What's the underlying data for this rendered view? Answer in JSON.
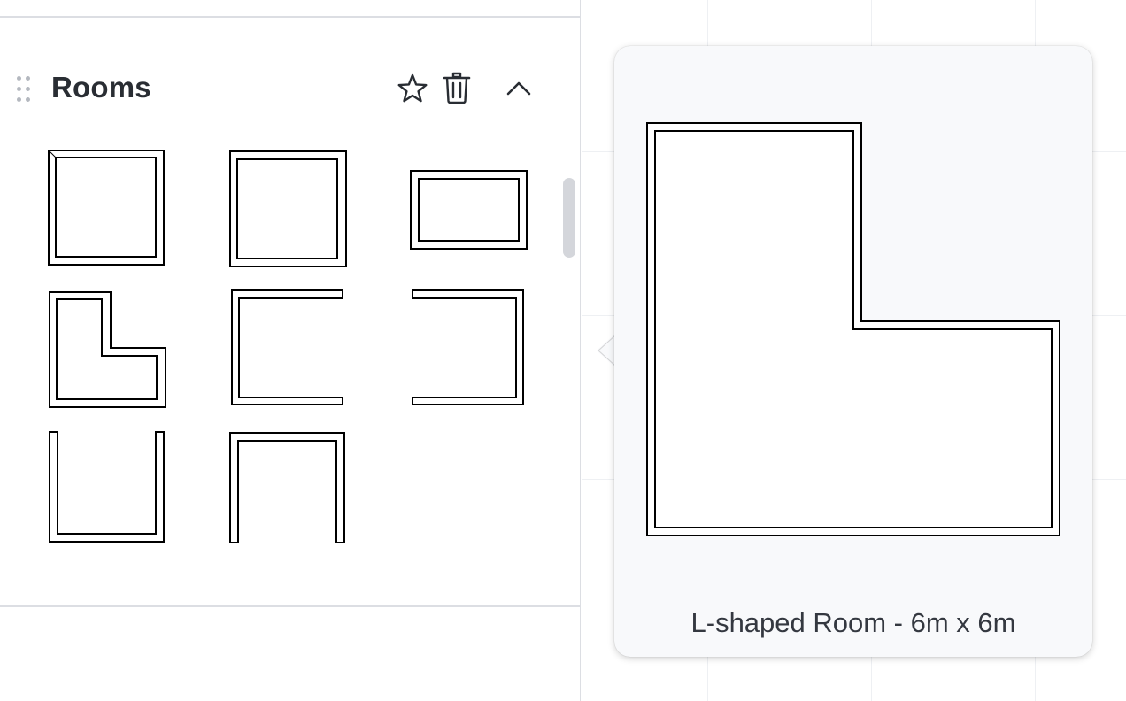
{
  "library": {
    "section_title": "Rooms",
    "actions": {
      "favorite_icon": "star-icon",
      "delete_icon": "trash-icon",
      "collapse_icon": "chevron-up-icon"
    },
    "shapes": [
      {
        "icon": "square-room-icon"
      },
      {
        "icon": "square-room-icon"
      },
      {
        "icon": "rectangular-room-icon"
      },
      {
        "icon": "l-shaped-room-icon"
      },
      {
        "icon": "u-room-open-right-icon"
      },
      {
        "icon": "u-room-open-left-icon"
      },
      {
        "icon": "u-room-open-top-icon"
      },
      {
        "icon": "u-room-open-bottom-icon"
      }
    ]
  },
  "tooltip": {
    "caption": "L-shaped Room - 6m x 6m",
    "preview_icon": "l-shaped-room-preview"
  },
  "colors": {
    "title": "#292d33",
    "stroke": "#000000",
    "tooltip_bg": "#f8f9fb",
    "divider": "#dcdee3"
  }
}
